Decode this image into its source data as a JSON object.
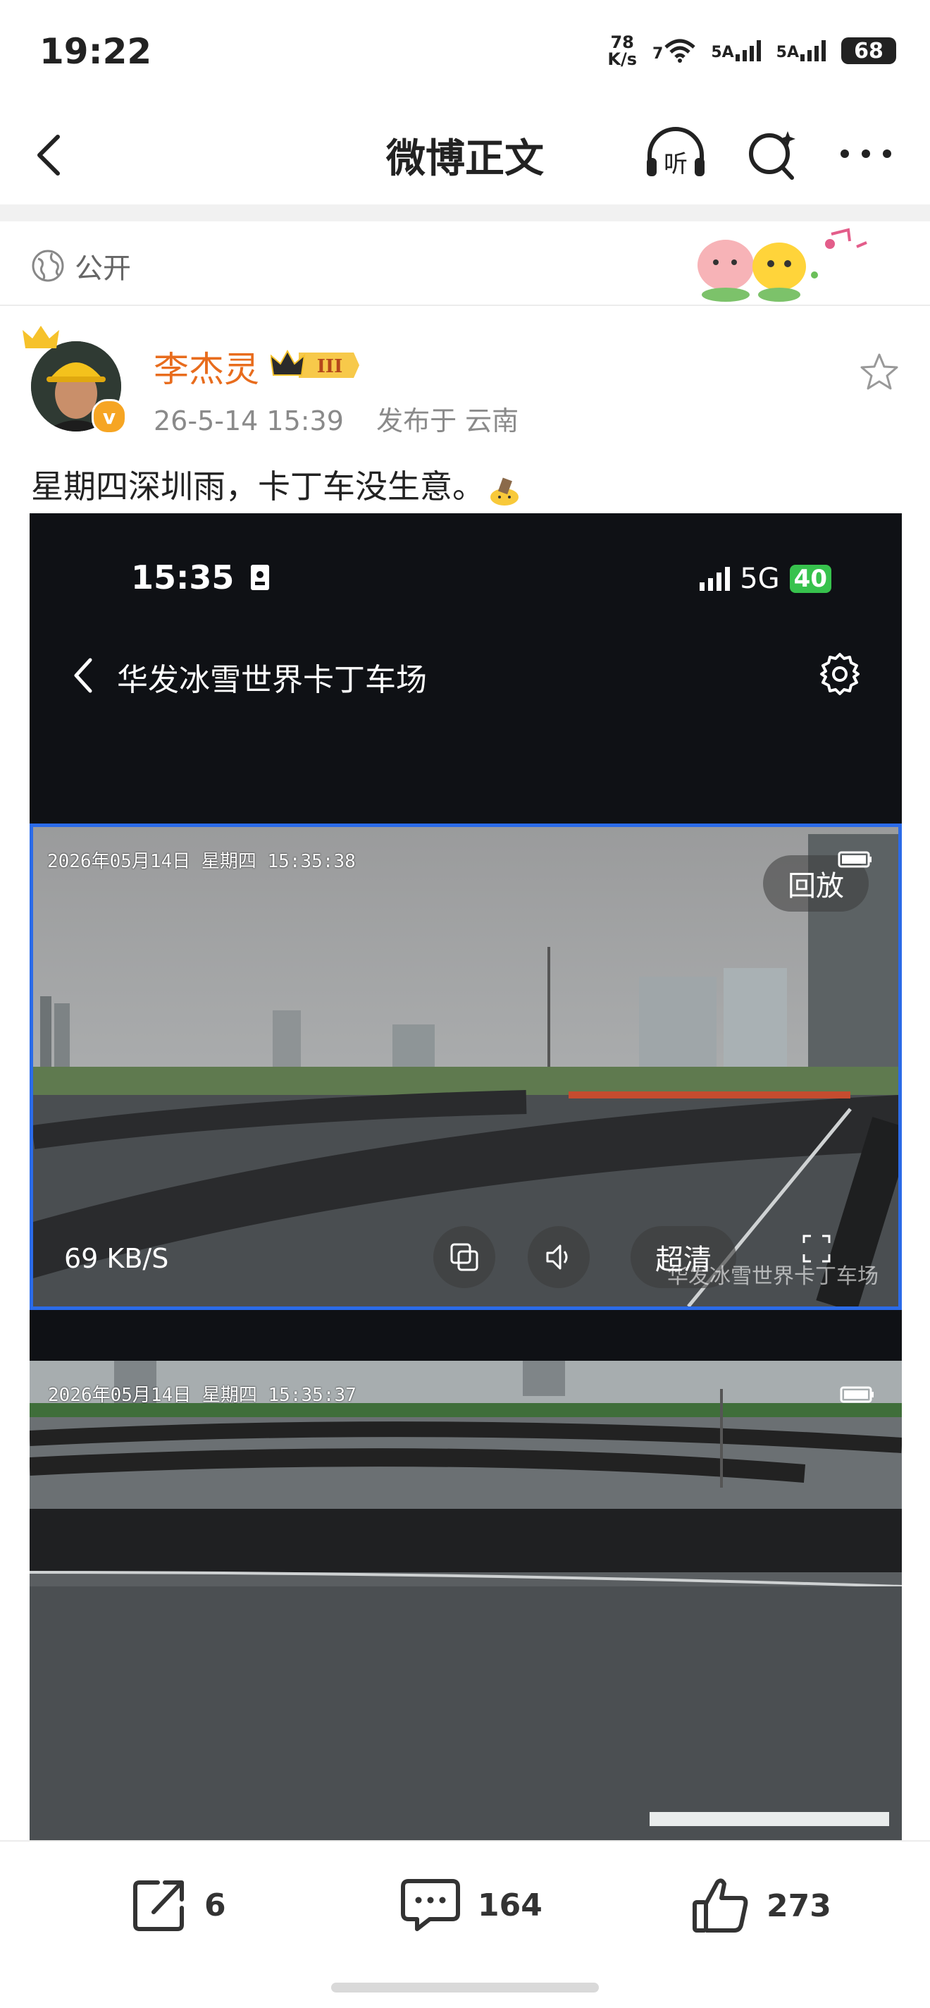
{
  "status_bar": {
    "time": "19:22",
    "net_speed_value": "78",
    "net_speed_unit": "K/s",
    "wifi_label": "7",
    "sim1_label": "5A",
    "sim2_label": "5A",
    "battery": "68"
  },
  "nav": {
    "title": "微博正文",
    "listen_label": "听"
  },
  "visibility": {
    "label": "公开"
  },
  "author": {
    "name": "李杰灵",
    "level_badge": "III",
    "timestamp": "26-5-14 15:39",
    "location": "发布于 云南",
    "verified": "v"
  },
  "post": {
    "text": "星期四深圳雨，卡丁车没生意。"
  },
  "screenshot": {
    "phone_time": "15:35",
    "network": "5G",
    "battery": "40",
    "page_title": "华发冰雪世界卡丁车场",
    "cam1": {
      "timestamp": "2026年05月14日  星期四  15:35:38",
      "replay_label": "回放",
      "speed": "69 KB/S",
      "quality_label": "超清",
      "watermark": "华发冰雪世界卡丁车场"
    },
    "cam2": {
      "timestamp": "2026年05月14日  星期四  15:35:37"
    }
  },
  "actions": {
    "repost_count": "6",
    "comment_count": "164",
    "like_count": "273"
  },
  "colors": {
    "author_name": "#e86c1d",
    "selection_border": "#2b6be8",
    "battery_green": "#37c24d"
  }
}
